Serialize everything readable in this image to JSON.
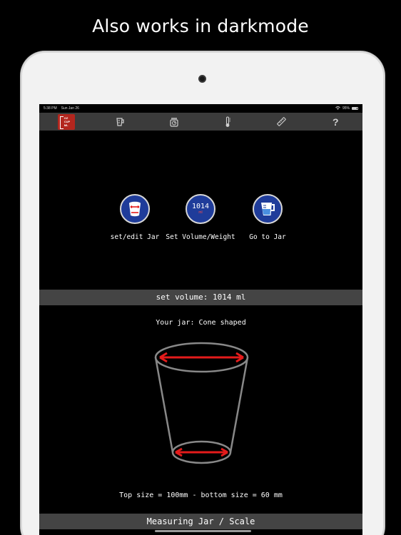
{
  "headline": "Also works in darkmode",
  "status": {
    "time": "5:38 PM",
    "date": "Sun Jan 26",
    "battery": "95%"
  },
  "toolbar": {
    "logo_lines": [
      "OZ",
      "CUP",
      "ML"
    ],
    "items": [
      {
        "name": "measuring-cup-icon",
        "glyph": "⊔"
      },
      {
        "name": "scale-icon",
        "glyph": "⚖"
      },
      {
        "name": "thermometer-icon",
        "glyph": "🌡"
      },
      {
        "name": "ruler-icon",
        "glyph": "📏"
      },
      {
        "name": "help-icon",
        "glyph": "?"
      }
    ]
  },
  "actions": {
    "edit_jar": "set/edit Jar",
    "set_volume": "Set Volume/Weight",
    "set_volume_number": "1014",
    "set_volume_unit": "ml",
    "go_to_jar": "Go to Jar"
  },
  "volume_bar": "set volume: 1014 ml",
  "jar": {
    "title": "Your jar: Cone shaped",
    "size_text": "Top size = 100mm - bottom size = 60 mm"
  },
  "footer_bar": "Measuring Jar / Scale",
  "colors": {
    "accent_blue": "#1f3c9a",
    "arrow_red": "#e41b1b",
    "bar_gray": "#444444",
    "logo_red": "#b3261e"
  }
}
